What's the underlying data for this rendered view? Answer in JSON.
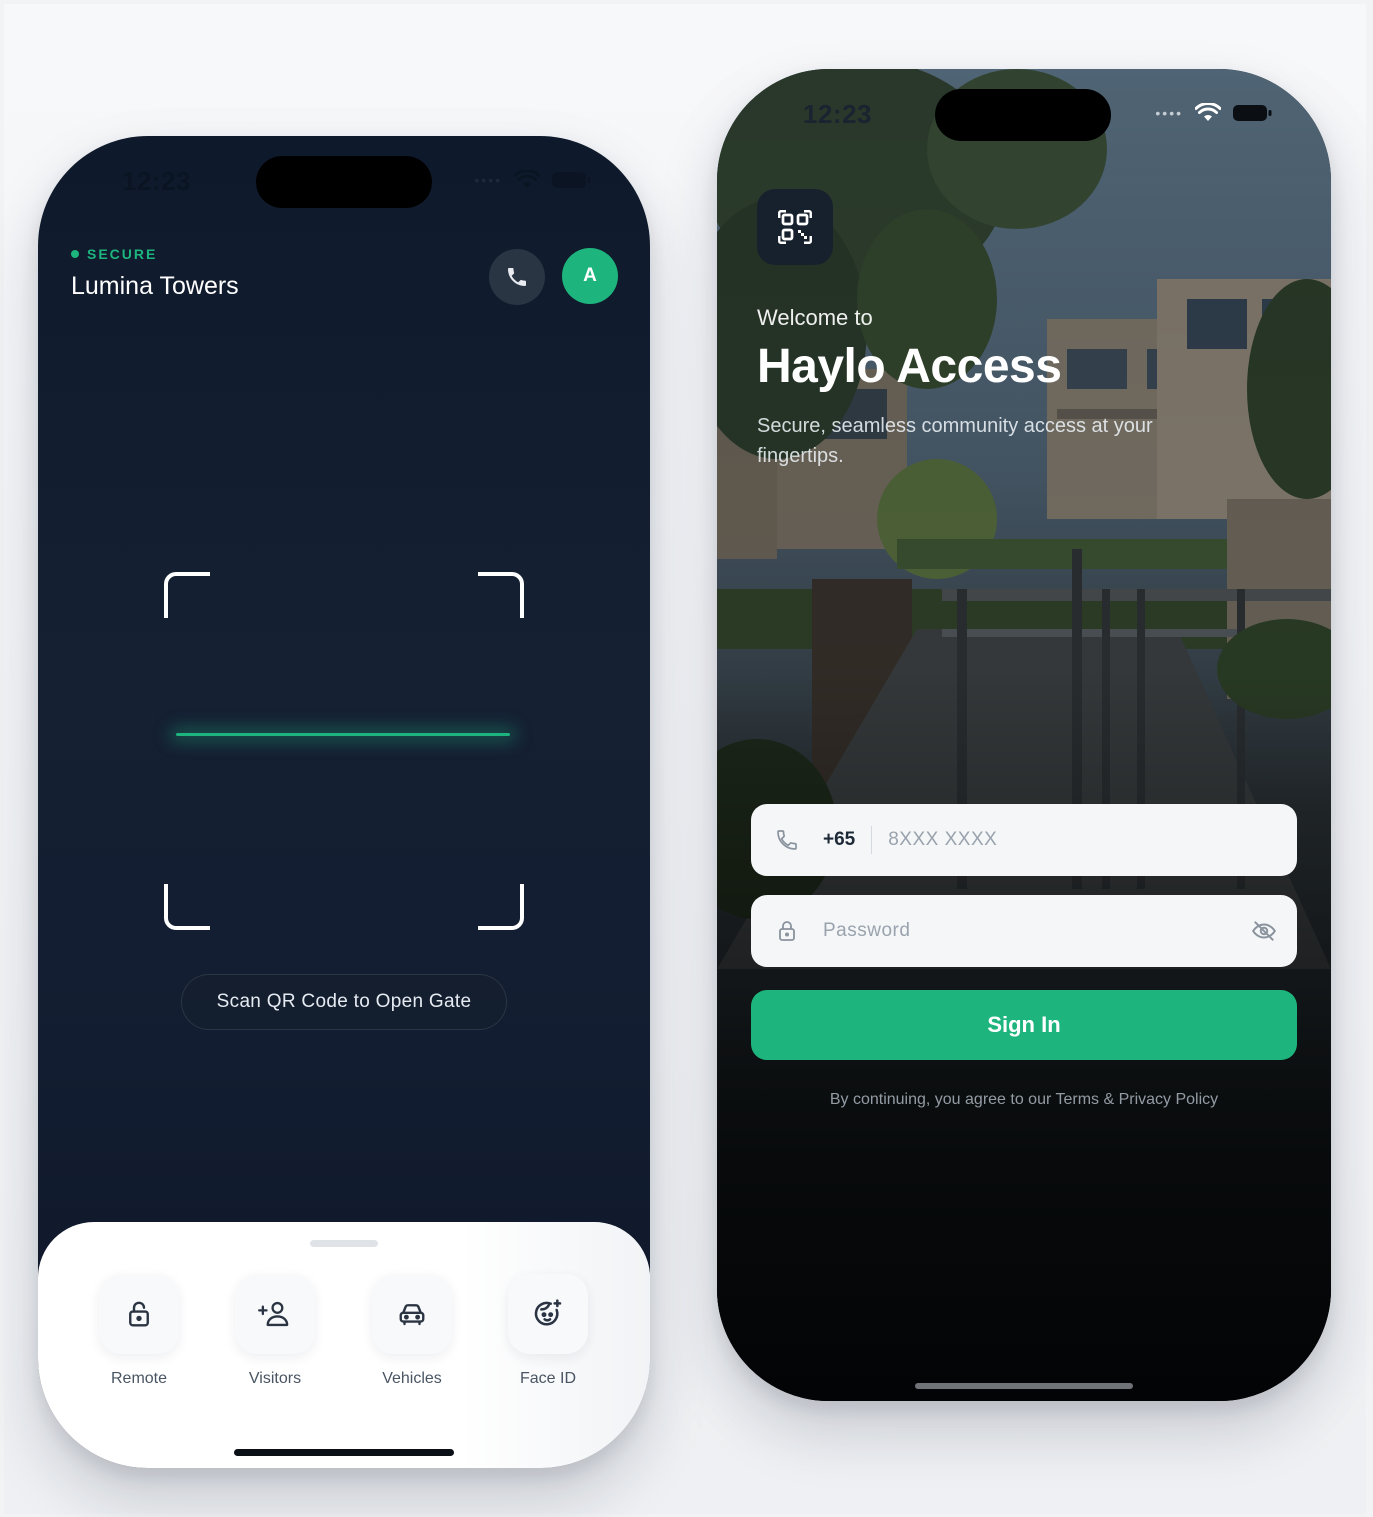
{
  "colors": {
    "accent": "#1db57d",
    "dark_bg": "#131d31",
    "sheet_bg": "#ffffff"
  },
  "scanner_screen": {
    "status": {
      "time": "12:23"
    },
    "header": {
      "status_label": "SECURE",
      "building_name": "Lumina Towers",
      "avatar_initial": "A"
    },
    "scan_hint": "Scan QR Code to Open Gate",
    "actions": [
      {
        "label": "Remote",
        "icon": "lock-icon"
      },
      {
        "label": "Visitors",
        "icon": "add-person-icon"
      },
      {
        "label": "Vehicles",
        "icon": "car-icon"
      },
      {
        "label": "Face ID",
        "icon": "face-icon"
      }
    ]
  },
  "login_screen": {
    "status": {
      "time": "12:23"
    },
    "welcome": "Welcome to",
    "app_name": "Haylo Access",
    "tagline": "Secure, seamless community access at your fingertips.",
    "phone_field": {
      "country_code": "+65",
      "placeholder": "8XXX XXXX"
    },
    "password_field": {
      "placeholder": "Password"
    },
    "sign_in_label": "Sign In",
    "terms": "By continuing, you agree to our Terms & Privacy Policy"
  }
}
